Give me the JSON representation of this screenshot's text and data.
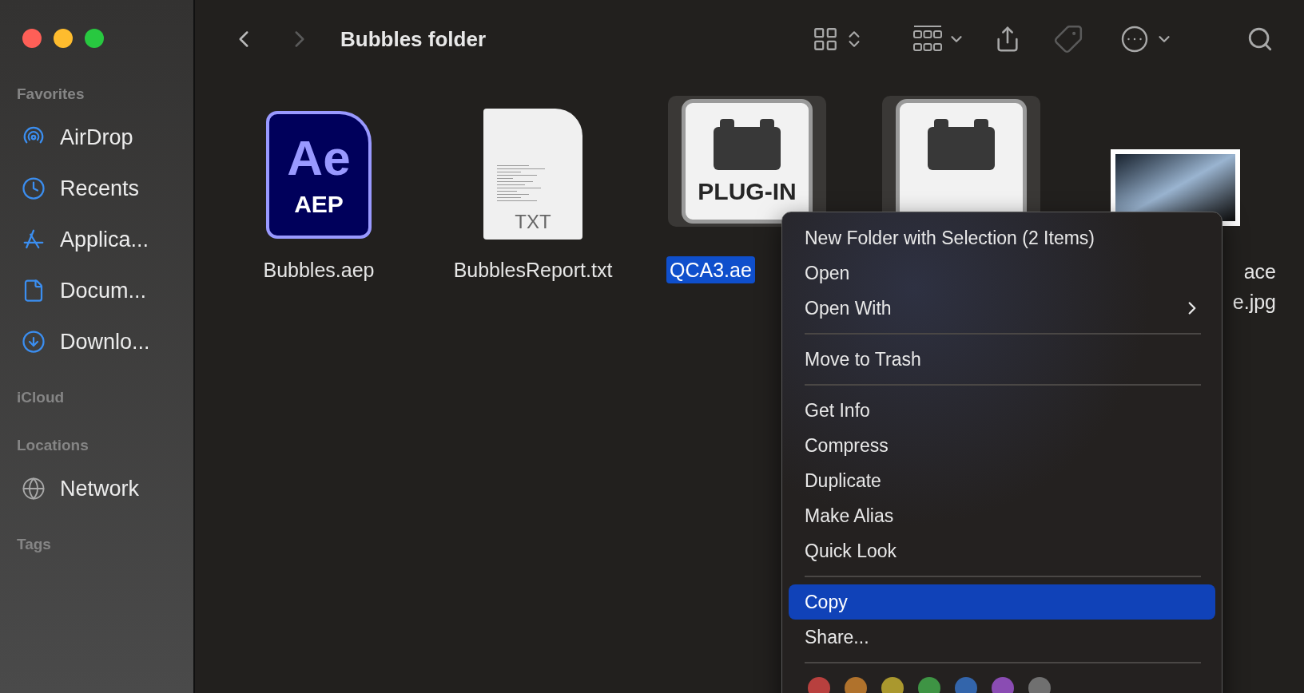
{
  "window": {
    "title": "Bubbles folder"
  },
  "nav": {
    "back_disabled": false,
    "forward_disabled": true
  },
  "sidebar": [
    {
      "title": "Favorites",
      "items": [
        {
          "label": "AirDrop",
          "kind": "airdrop"
        },
        {
          "label": "Recents",
          "kind": "recents"
        },
        {
          "label": "Applica...",
          "kind": "applications"
        },
        {
          "label": "Docum...",
          "kind": "documents"
        },
        {
          "label": "Downlo...",
          "kind": "downloads"
        }
      ]
    },
    {
      "title": "iCloud"
    },
    {
      "title": "Locations",
      "items": [
        {
          "label": "Network",
          "kind": "network"
        }
      ]
    },
    {
      "title": "Tags"
    }
  ],
  "files": [
    {
      "kind": "aep",
      "icon_text": "Ae",
      "icon_badge": "AEP",
      "label": "Bubbles.aep",
      "selected": false
    },
    {
      "kind": "txt",
      "icon_badge": "TXT",
      "label": "BubblesReport.txt",
      "selected": false
    },
    {
      "kind": "plugin",
      "icon_badge": "PLUG-IN",
      "label": "QCA3.ae",
      "selected": true
    },
    {
      "kind": "plugin",
      "selected": true
    },
    {
      "kind": "image",
      "label_lines": [
        "ace",
        "e.jpg"
      ],
      "selected": false
    }
  ],
  "context_menu": [
    {
      "kind": "item",
      "label": "New Folder with Selection (2 Items)",
      "selected": false
    },
    {
      "kind": "item",
      "label": "Open",
      "selected": false
    },
    {
      "kind": "item",
      "label": "Open With",
      "selected": false,
      "submenu": true
    },
    {
      "kind": "separator"
    },
    {
      "kind": "item",
      "label": "Move to Trash",
      "selected": false
    },
    {
      "kind": "separator"
    },
    {
      "kind": "item",
      "label": "Get Info",
      "selected": false
    },
    {
      "kind": "item",
      "label": "Compress",
      "selected": false
    },
    {
      "kind": "item",
      "label": "Duplicate",
      "selected": false
    },
    {
      "kind": "item",
      "label": "Make Alias",
      "selected": false
    },
    {
      "kind": "item",
      "label": "Quick Look",
      "selected": false
    },
    {
      "kind": "separator"
    },
    {
      "kind": "item",
      "label": "Copy",
      "selected": true
    },
    {
      "kind": "item",
      "label": "Share...",
      "selected": false
    },
    {
      "kind": "separator"
    },
    {
      "kind": "tags",
      "colors": [
        {
          "color": "#b8403e"
        },
        {
          "color": "#b0722c"
        },
        {
          "color": "#aa982e"
        },
        {
          "color": "#3e9444"
        },
        {
          "color": "#3365ab"
        },
        {
          "color": "#8a4cb3"
        },
        {
          "color": "#707070"
        }
      ]
    }
  ]
}
